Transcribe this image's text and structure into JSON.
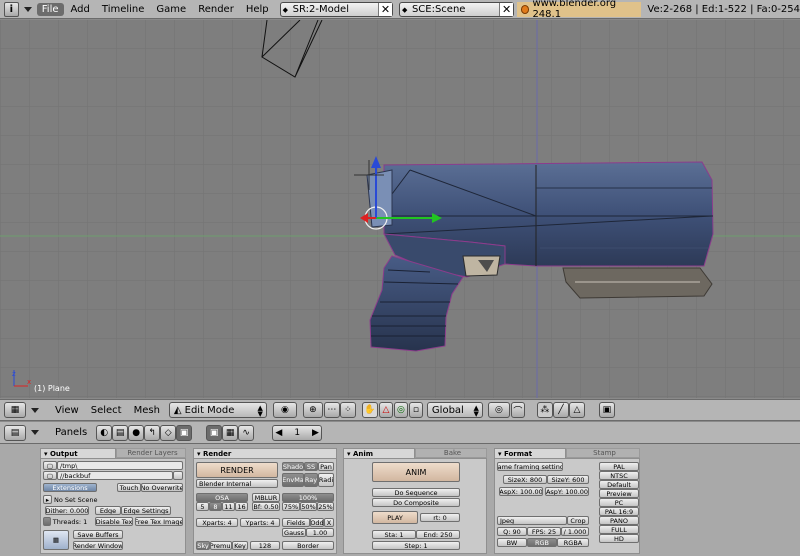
{
  "top_menu": {
    "items": [
      "File",
      "Add",
      "Timeline",
      "Game",
      "Render",
      "Help"
    ],
    "active": "File",
    "screen_field": "SR:2-Model",
    "scene_field": "SCE:Scene",
    "blender_url": "www.blender.org 248.1",
    "stats": "Ve:2-268 | Ed:1-522 | Fa:0-254"
  },
  "viewport": {
    "object_label": "(1) Plane"
  },
  "view_header": {
    "menus": [
      "View",
      "Select",
      "Mesh"
    ],
    "mode": "Edit Mode",
    "orientation": "Global"
  },
  "buttons_header": {
    "panels_label": "Panels",
    "frame": "1"
  },
  "output_panel": {
    "tab_active": "Output",
    "tab_inactive": "Render Layers",
    "path1": "/tmp\\",
    "path2": "//backbuf",
    "extensions": "Extensions",
    "touch": "Touch",
    "no_overwrite": "No Overwrite",
    "no_set_scene": "No Set Scene",
    "dither": "Dither: 0.000",
    "edge": "Edge",
    "edge_settings": "Edge Settings",
    "threads": "Threads: 1",
    "disable_tex": "Disable Tex",
    "free_tex_image": "Free Tex Image",
    "save_buffers": "Save Buffers",
    "render_window": "Render Window"
  },
  "render_panel": {
    "tab": "Render",
    "render": "RENDER",
    "renderer": "Blender Internal",
    "shado": "Shado",
    "ss": "SS",
    "pan": "Pan",
    "envma": "EnvMa",
    "ray": "Ray",
    "radi": "Radi",
    "osa": "OSA",
    "mblur": "MBLUR",
    "percent": "100%",
    "osa_vals": [
      "5",
      "8",
      "11",
      "16"
    ],
    "bf": "Bf: 0.50",
    "pct_vals": [
      "75%",
      "50%",
      "25%"
    ],
    "xparts": "Xparts: 4",
    "yparts": "Yparts: 4",
    "fields": "Fields",
    "odd": "Odd",
    "x": "X",
    "gauss": "Gauss",
    "gauss_val": "1.00",
    "sky": "Sky",
    "premul": "Premul",
    "key": "Key",
    "depth": "128",
    "border": "Border"
  },
  "anim_panel": {
    "tab_active": "Anim",
    "tab_inactive": "Bake",
    "anim": "ANIM",
    "do_sequence": "Do Sequence",
    "do_composite": "Do Composite",
    "play": "PLAY",
    "rt": "rt: 0",
    "sta": "Sta: 1",
    "end": "End: 250",
    "step": "Step: 1"
  },
  "format_panel": {
    "tab_active": "Format",
    "tab_inactive": "Stamp",
    "game_framing": "Game framing settings",
    "sizex": "SizeX: 800",
    "sizey": "SizeY: 600",
    "aspx": "AspX: 100.00",
    "aspy": "AspY: 100.00",
    "codec": "Jpeg",
    "crop": "Crop",
    "q": "Q: 90",
    "fps": "FPS: 25",
    "fps_div": "/ 1.000",
    "bw": "BW",
    "rgb": "RGB",
    "rgba": "RGBA",
    "presets": [
      "PAL",
      "NTSC",
      "Default",
      "Preview",
      "PC",
      "PAL 16:9",
      "PANO",
      "FULL",
      "HD"
    ]
  }
}
